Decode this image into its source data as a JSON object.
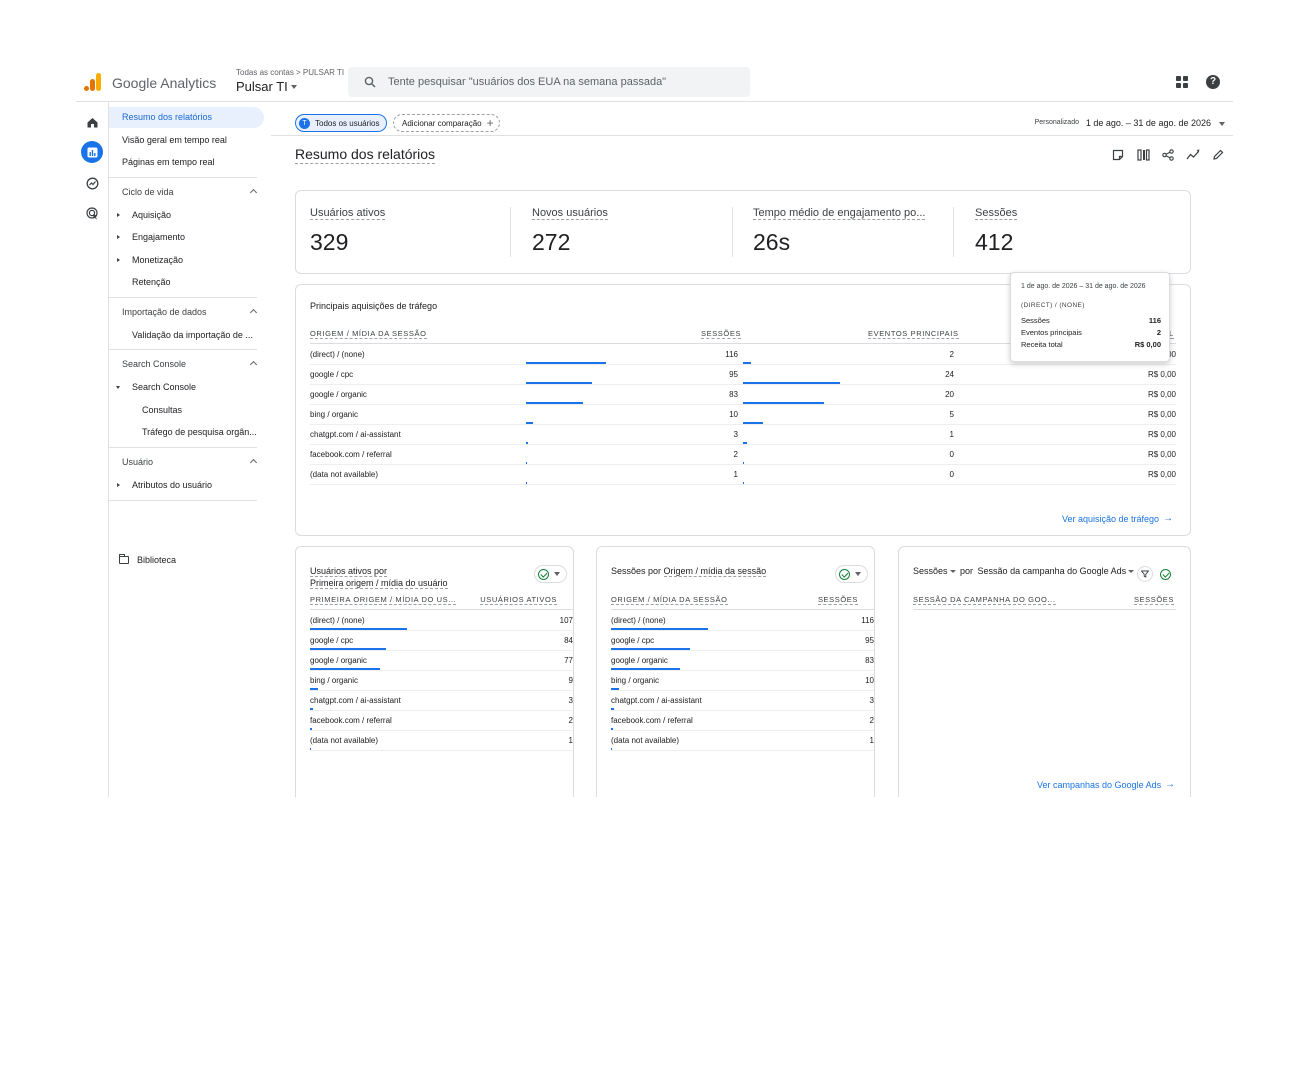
{
  "header": {
    "product": "Google Analytics",
    "breadcrumb": "Todas as contas > PULSAR TI",
    "property": "Pulsar TI",
    "search_placeholder": "Tente pesquisar \"usuários dos EUA na semana passada\""
  },
  "nav": {
    "items": [
      "Resumo dos relatórios",
      "Visão geral em tempo real",
      "Páginas em tempo real"
    ],
    "lifecycle": {
      "label": "Ciclo de vida",
      "children": [
        "Aquisição",
        "Engajamento",
        "Monetização",
        "Retenção"
      ]
    },
    "data_import": {
      "label": "Importação de dados",
      "children": [
        "Validação da importação de ..."
      ]
    },
    "search_console": {
      "label": "Search Console",
      "child": "Search Console",
      "children": [
        "Consultas",
        "Tráfego de pesquisa orgân..."
      ]
    },
    "user": {
      "label": "Usuário",
      "children": [
        "Atributos do usuário"
      ]
    },
    "library": "Biblioteca"
  },
  "topbar": {
    "segment_chip": "Todos os usuários",
    "segment_initial": "T",
    "add_comparison": "Adicionar comparação",
    "date_mode": "Personalizado",
    "date_range": "1 de ago. – 31 de ago. de 2026"
  },
  "page_title": "Resumo dos relatórios",
  "metrics": [
    {
      "label": "Usuários ativos",
      "value": "329"
    },
    {
      "label": "Novos usuários",
      "value": "272"
    },
    {
      "label": "Tempo médio de engajamento po...",
      "value": "26s"
    },
    {
      "label": "Sessões",
      "value": "412"
    }
  ],
  "traffic": {
    "title": "Principais aquisições de tráfego",
    "col_source": "ORIGEM / MÍDIA DA SESSÃO",
    "col_sessions": "SESSÕES",
    "col_events": "EVENTOS PRINCIPAIS",
    "col_revenue": "L",
    "rows": [
      {
        "source": "(direct) / (none)",
        "sessions": "116",
        "events": "2",
        "revenue": "R$ 0,00",
        "sessions_num": 116,
        "events_num": 2
      },
      {
        "source": "google / cpc",
        "sessions": "95",
        "events": "24",
        "revenue": "R$ 0,00",
        "sessions_num": 95,
        "events_num": 24
      },
      {
        "source": "google / organic",
        "sessions": "83",
        "events": "20",
        "revenue": "R$ 0,00",
        "sessions_num": 83,
        "events_num": 20
      },
      {
        "source": "bing / organic",
        "sessions": "10",
        "events": "5",
        "revenue": "R$ 0,00",
        "sessions_num": 10,
        "events_num": 5
      },
      {
        "source": "chatgpt.com / ai-assistant",
        "sessions": "3",
        "events": "1",
        "revenue": "R$ 0,00",
        "sessions_num": 3,
        "events_num": 1
      },
      {
        "source": "facebook.com / referral",
        "sessions": "2",
        "events": "0",
        "revenue": "R$ 0,00",
        "sessions_num": 2,
        "events_num": 0
      },
      {
        "source": "(data not available)",
        "sessions": "1",
        "events": "0",
        "revenue": "R$ 0,00",
        "sessions_num": 1,
        "events_num": 0
      }
    ],
    "link": "Ver aquisição de tráfego"
  },
  "tooltip": {
    "date": "1 de ago. de 2026 – 31 de ago. de 2026",
    "source": "(DIRECT) / (NONE)",
    "rows": [
      {
        "label": "Sessões",
        "value": "116"
      },
      {
        "label": "Eventos principais",
        "value": "2"
      },
      {
        "label": "Receita total",
        "value": "R$ 0,00"
      }
    ]
  },
  "active_users_card": {
    "title_line1": "Usuários ativos por",
    "title_line2": "Primeira origem / mídia do usuário",
    "col_source": "PRIMEIRA ORIGEM / MÍDIA DO US...",
    "col_value": "USUÁRIOS ATIVOS",
    "rows": [
      {
        "source": "(direct) / (none)",
        "value": "107",
        "num": 107
      },
      {
        "source": "google / cpc",
        "value": "84",
        "num": 84
      },
      {
        "source": "google / organic",
        "value": "77",
        "num": 77
      },
      {
        "source": "bing / organic",
        "value": "9",
        "num": 9
      },
      {
        "source": "chatgpt.com / ai-assistant",
        "value": "3",
        "num": 3
      },
      {
        "source": "facebook.com / referral",
        "value": "2",
        "num": 2
      },
      {
        "source": "(data not available)",
        "value": "1",
        "num": 1
      }
    ]
  },
  "sessions_card": {
    "title_prefix": "Sessões por ",
    "title_underlined": "Origem / mídia da sessão",
    "col_source": "ORIGEM / MÍDIA DA SESSÃO",
    "col_value": "SESSÕES",
    "rows": [
      {
        "source": "(direct) / (none)",
        "value": "116",
        "num": 116
      },
      {
        "source": "google / cpc",
        "value": "95",
        "num": 95
      },
      {
        "source": "google / organic",
        "value": "83",
        "num": 83
      },
      {
        "source": "bing / organic",
        "value": "10",
        "num": 10
      },
      {
        "source": "chatgpt.com / ai-assistant",
        "value": "3",
        "num": 3
      },
      {
        "source": "facebook.com / referral",
        "value": "2",
        "num": 2
      },
      {
        "source": "(data not available)",
        "value": "1",
        "num": 1
      }
    ]
  },
  "ads_card": {
    "title_metric": "Sessões",
    "title_mid": " por ",
    "title_dim": "Sessão da campanha do Google Ads",
    "col_source": "SESSÃO DA CAMPANHA DO GOO...",
    "col_value": "SESSÕES",
    "link": "Ver campanhas do Google Ads"
  },
  "colors": {
    "accent": "#1a73e8",
    "bar": "#1a73e8",
    "check": "#188038"
  }
}
